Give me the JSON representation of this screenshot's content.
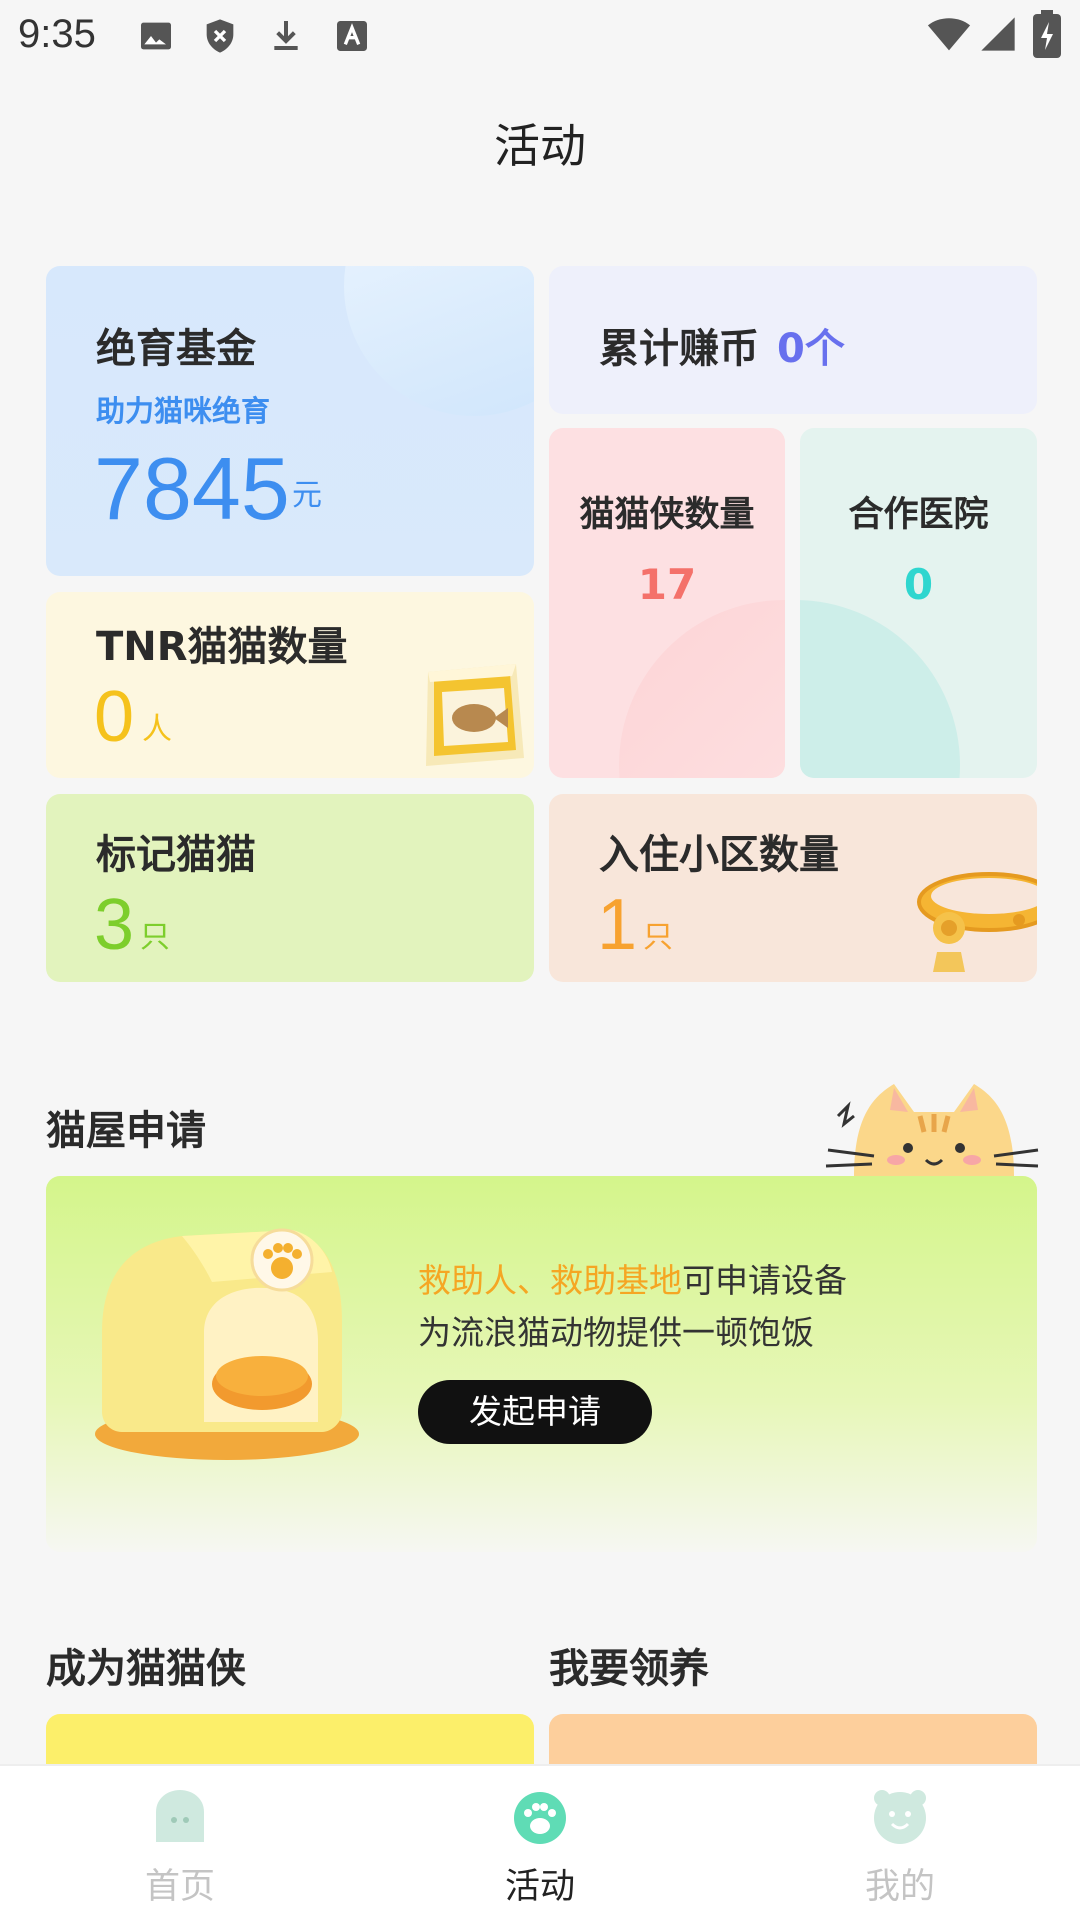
{
  "status_bar": {
    "time": "9:35"
  },
  "header": {
    "title": "活动"
  },
  "fund": {
    "title": "绝育基金",
    "subtitle": "助力猫咪绝育",
    "amount": "7845",
    "unit": "元"
  },
  "coins": {
    "label": "累计赚币",
    "value": "0个"
  },
  "heroes": {
    "label": "猫猫侠数量",
    "value": "17"
  },
  "hospitals": {
    "label": "合作医院",
    "value": "0"
  },
  "tnr": {
    "label": "TNR猫猫数量",
    "value": "0",
    "unit": "人"
  },
  "marked": {
    "label": "标记猫猫",
    "value": "3",
    "unit": "只"
  },
  "communities": {
    "label": "入住小区数量",
    "value": "1",
    "unit": "只"
  },
  "cat_house": {
    "title": "猫屋申请",
    "line1_highlight": "救助人、救助基地",
    "line1_rest": "可申请设备",
    "line2": "为流浪猫动物提供一顿饱饭",
    "button": "发起申请"
  },
  "sections": {
    "become_hero": "成为猫猫侠",
    "adopt": "我要领养"
  },
  "tabbar": {
    "home": "首页",
    "activity": "活动",
    "mine": "我的"
  },
  "colors": {
    "accent_blue": "#3d8ef0",
    "accent_green": "#5fdcb5",
    "orange": "#f5a623"
  }
}
